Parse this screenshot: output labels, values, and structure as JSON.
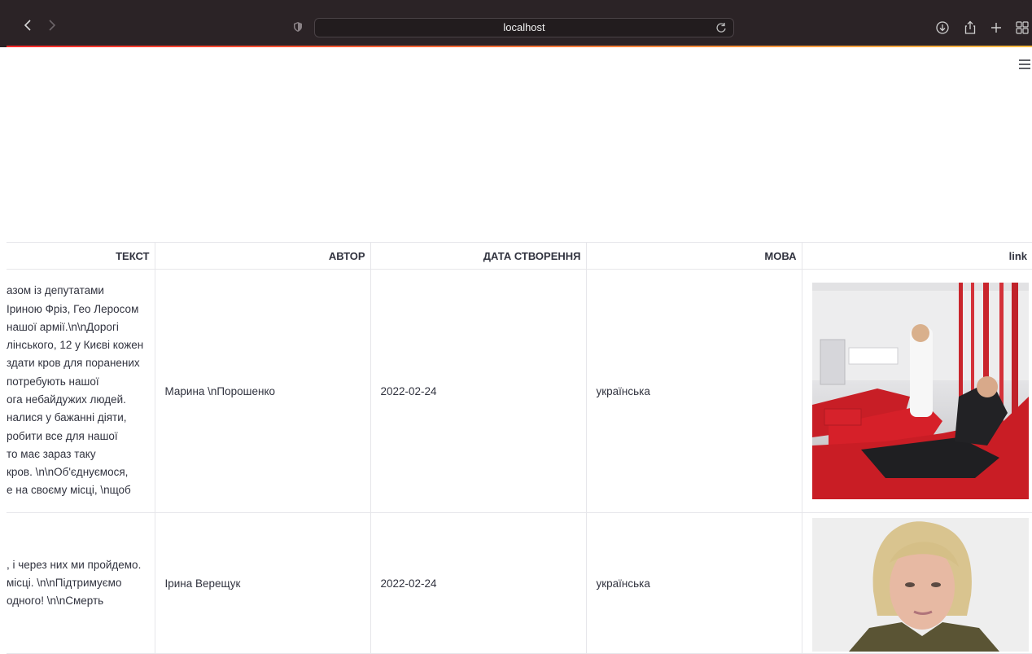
{
  "browser": {
    "url": "localhost"
  },
  "icons": {
    "back": "chevron-left-icon",
    "forward": "chevron-right-icon",
    "shield": "shield-icon",
    "reload": "reload-icon",
    "download": "download-icon",
    "share": "share-icon",
    "new_tab": "plus-icon",
    "tabs": "tab-overview-icon",
    "menu": "hamburger-menu-icon"
  },
  "colors": {
    "toolbar_bg": "#2b2326",
    "accent_start": "#ff2b2b",
    "accent_end": "#ffbd45",
    "table_border": "#e6e6ea",
    "text": "#31333f"
  },
  "table": {
    "columns": [
      "ТЕКСТ",
      "АВТОР",
      "ДАТА СТВОРЕННЯ",
      "МОВА",
      "link"
    ],
    "rows": [
      {
        "text_lines": [
          "азом із депутатами",
          "Іриною Фріз, Гео Леросом",
          "нашої армії.\\n\\nДорогі",
          "лінського, 12 у Києві кожен",
          "здати кров для поранених",
          "потребують нашої",
          "ога небайдужих людей.",
          "налися у бажанні діяти,",
          "робити все для нашої",
          "то має зараз таку",
          "кров. \\n\\nОб'єднуємося,",
          "е на своєму місці, \\nщоб"
        ],
        "author": "Марина \\nПорошенко",
        "date": "2022-02-24",
        "language": "українська"
      },
      {
        "text_lines": [
          ", і через них ми пройдемо.",
          "місці. \\n\\nПідтримуємо",
          "одного! \\n\\nСмерть"
        ],
        "author": "Ірина Верещук",
        "date": "2022-02-24",
        "language": "українська"
      }
    ]
  }
}
